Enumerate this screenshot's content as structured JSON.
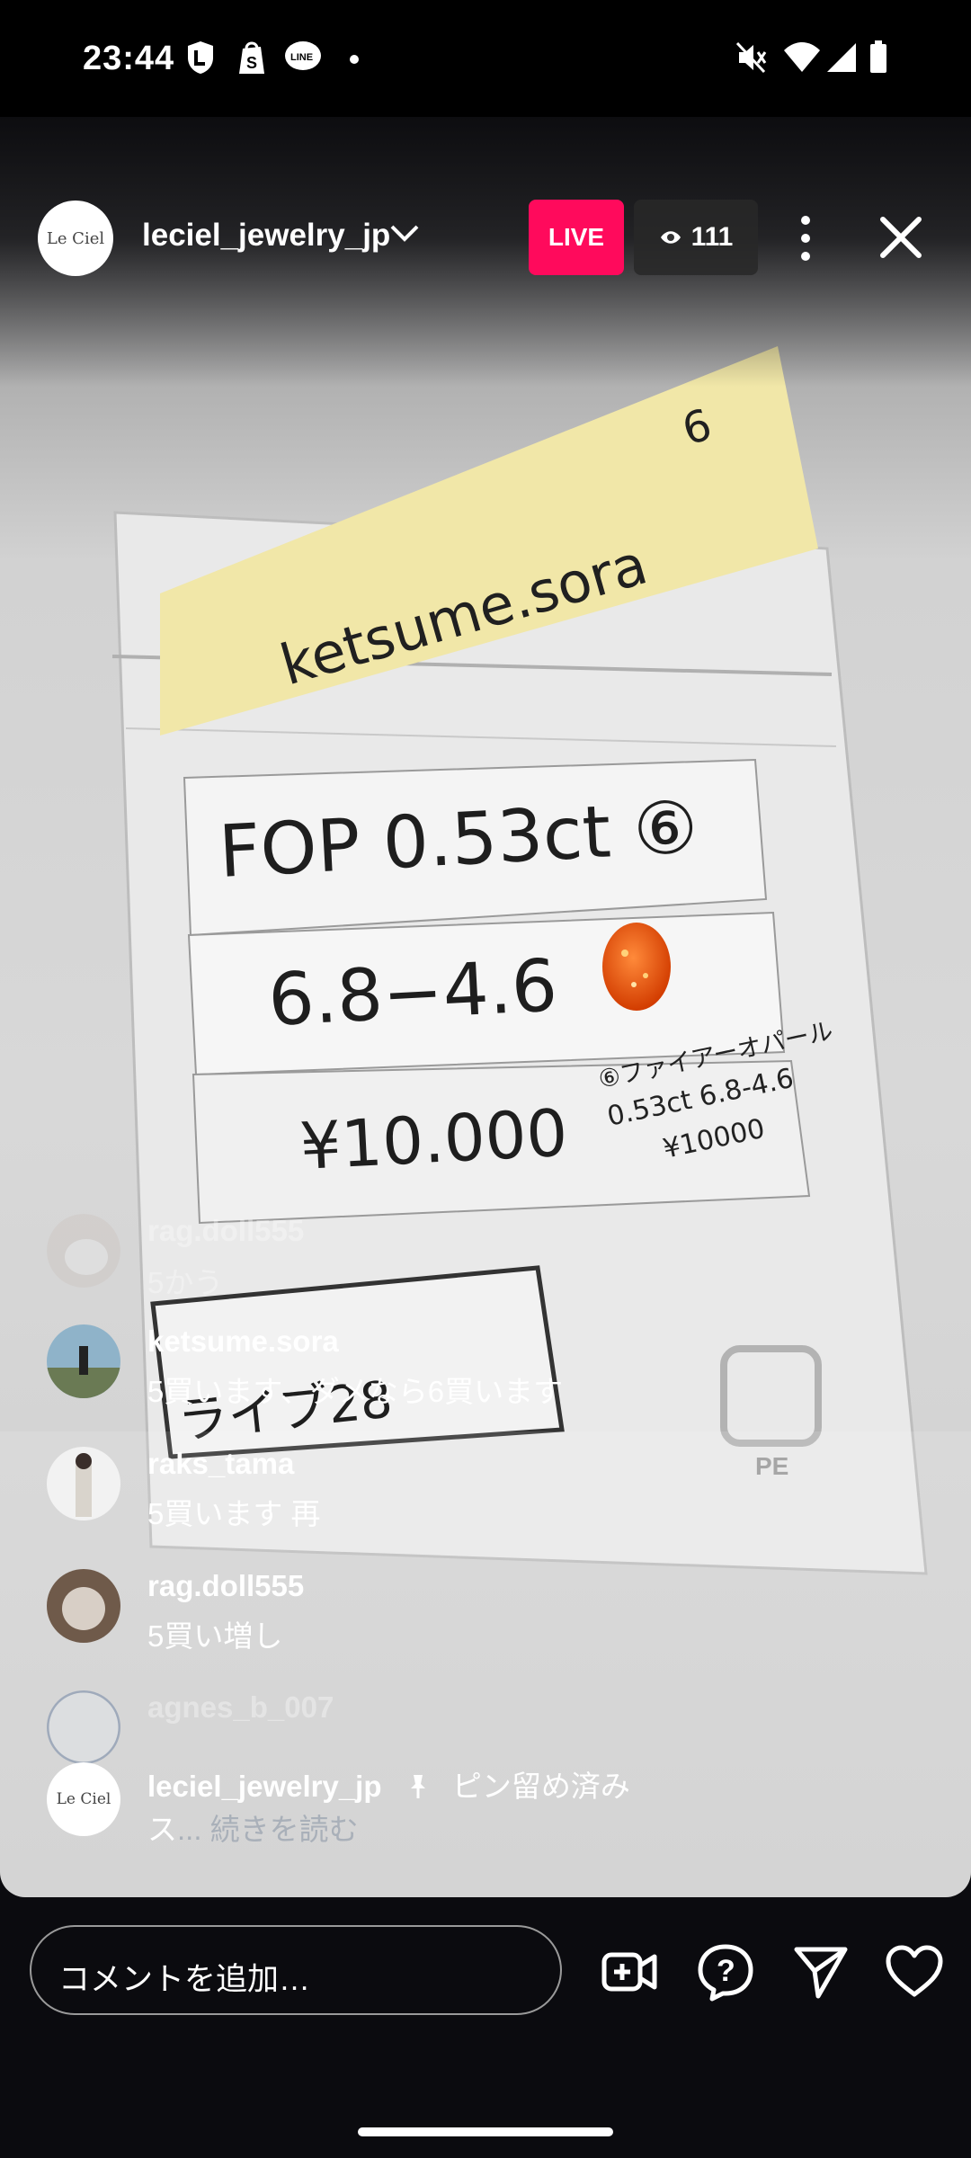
{
  "status_bar": {
    "time": "23:44"
  },
  "header": {
    "avatar_text": "Le Ciel",
    "username": "leciel_jewelry_jp",
    "live_label": "LIVE",
    "viewer_count": "111"
  },
  "photo": {
    "sticky_note": "ketsume.sora",
    "sticky_number": "6",
    "line1": "FOP 0.53ct ⑥",
    "line2": "6.8−4.6",
    "line3": "¥10.000",
    "printed1": "⑥ファイアーオパール",
    "printed2": "0.53ct 6.8-4.6",
    "printed3": "¥10000",
    "lower_label": "ライブ28",
    "pe_mark": "PE"
  },
  "comments": [
    {
      "user": "rag.doll555",
      "text": "5かう"
    },
    {
      "user": "ketsume.sora",
      "text": "5買います、ダメなら6買います"
    },
    {
      "user": "raks_tama",
      "text": "5買います 再"
    },
    {
      "user": "rag.doll555",
      "text": "5買い増し"
    },
    {
      "user": "agnes_b_007",
      "text": ""
    }
  ],
  "pinned": {
    "user": "leciel_jewelry_jp",
    "pin_label": "ピン留め済み",
    "text": "ス",
    "more": "... 続きを読む"
  },
  "bottom": {
    "comment_placeholder": "コメントを追加…"
  },
  "colors": {
    "live": "#ff0a5c",
    "background": "#0b0b0f"
  }
}
